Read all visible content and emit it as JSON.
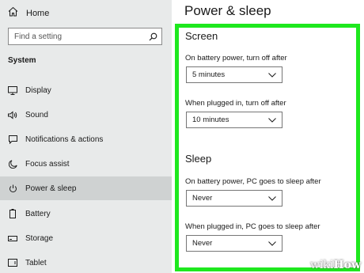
{
  "sidebar": {
    "home_label": "Home",
    "search_placeholder": "Find a setting",
    "section_label": "System",
    "items": [
      {
        "label": "Display",
        "icon": "display-icon"
      },
      {
        "label": "Sound",
        "icon": "speaker-icon"
      },
      {
        "label": "Notifications & actions",
        "icon": "notifications-icon"
      },
      {
        "label": "Focus assist",
        "icon": "moon-icon"
      },
      {
        "label": "Power & sleep",
        "icon": "power-icon",
        "active": true
      },
      {
        "label": "Battery",
        "icon": "battery-icon"
      },
      {
        "label": "Storage",
        "icon": "storage-icon"
      },
      {
        "label": "Tablet",
        "icon": "tablet-icon"
      }
    ]
  },
  "main": {
    "title": "Power & sleep",
    "screen": {
      "heading": "Screen",
      "battery_label": "On battery power, turn off after",
      "battery_value": "5 minutes",
      "plugged_label": "When plugged in, turn off after",
      "plugged_value": "10 minutes"
    },
    "sleep": {
      "heading": "Sleep",
      "battery_label": "On battery power, PC goes to sleep after",
      "battery_value": "Never",
      "plugged_label": "When plugged in, PC goes to sleep after",
      "plugged_value": "Never"
    }
  },
  "watermark": {
    "part1": "wiki",
    "part2": "How"
  },
  "colors": {
    "highlight": "#1ee81e",
    "sidebar_bg": "#e8eaea",
    "active_item": "#cfd2d2"
  }
}
